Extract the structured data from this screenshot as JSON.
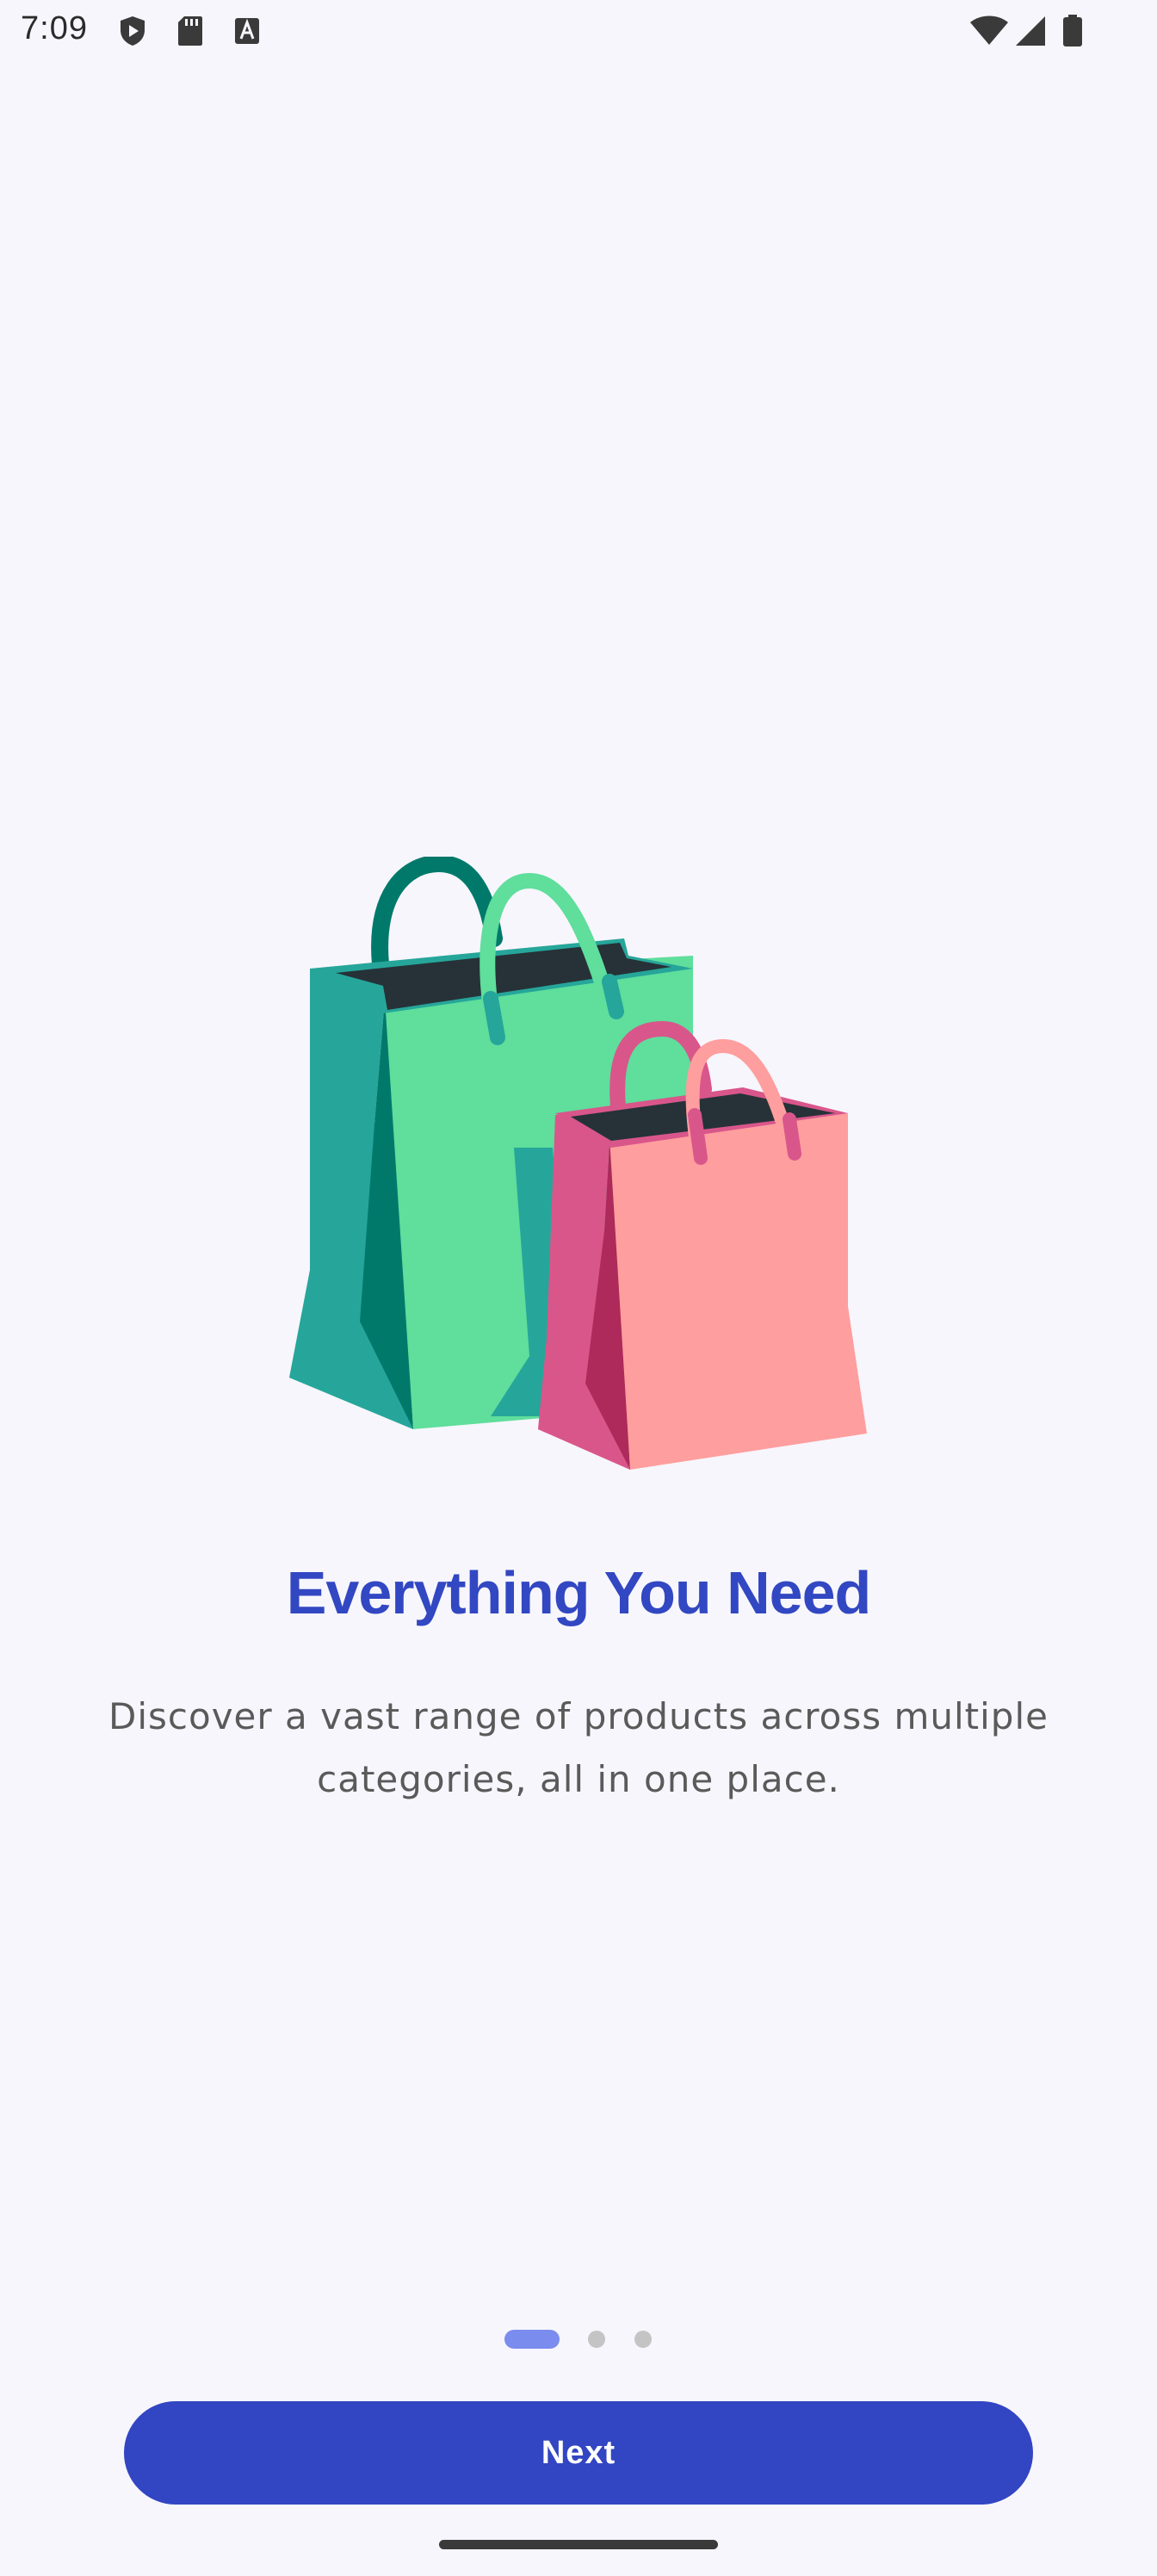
{
  "status_bar": {
    "time": "7:09",
    "icons": [
      "shield-play-icon",
      "sd-card-icon",
      "font-a-icon",
      "wifi-icon",
      "cell-signal-icon",
      "battery-icon"
    ]
  },
  "onboarding": {
    "illustration": "shopping-bags-illustration",
    "title": "Everything You Need",
    "description": "Discover a vast range of products across multiple categories, all in one place.",
    "page_indicator": {
      "current_page": 1,
      "total_pages": 3
    },
    "next_label": "Next"
  },
  "colors": {
    "background": "#f7f6fc",
    "title": "#3247c2",
    "button": "#3245c2",
    "active_dot": "#7b8cef",
    "inactive_dot": "#c4c4c4",
    "bag_green": "#5fde9c",
    "bag_teal": "#26a69a",
    "bag_dark_teal": "#00796b",
    "bag_pink": "#ff9e9e",
    "bag_magenta": "#d9568b",
    "bag_dark_magenta": "#ad2a5a",
    "bag_opening": "#263238"
  }
}
